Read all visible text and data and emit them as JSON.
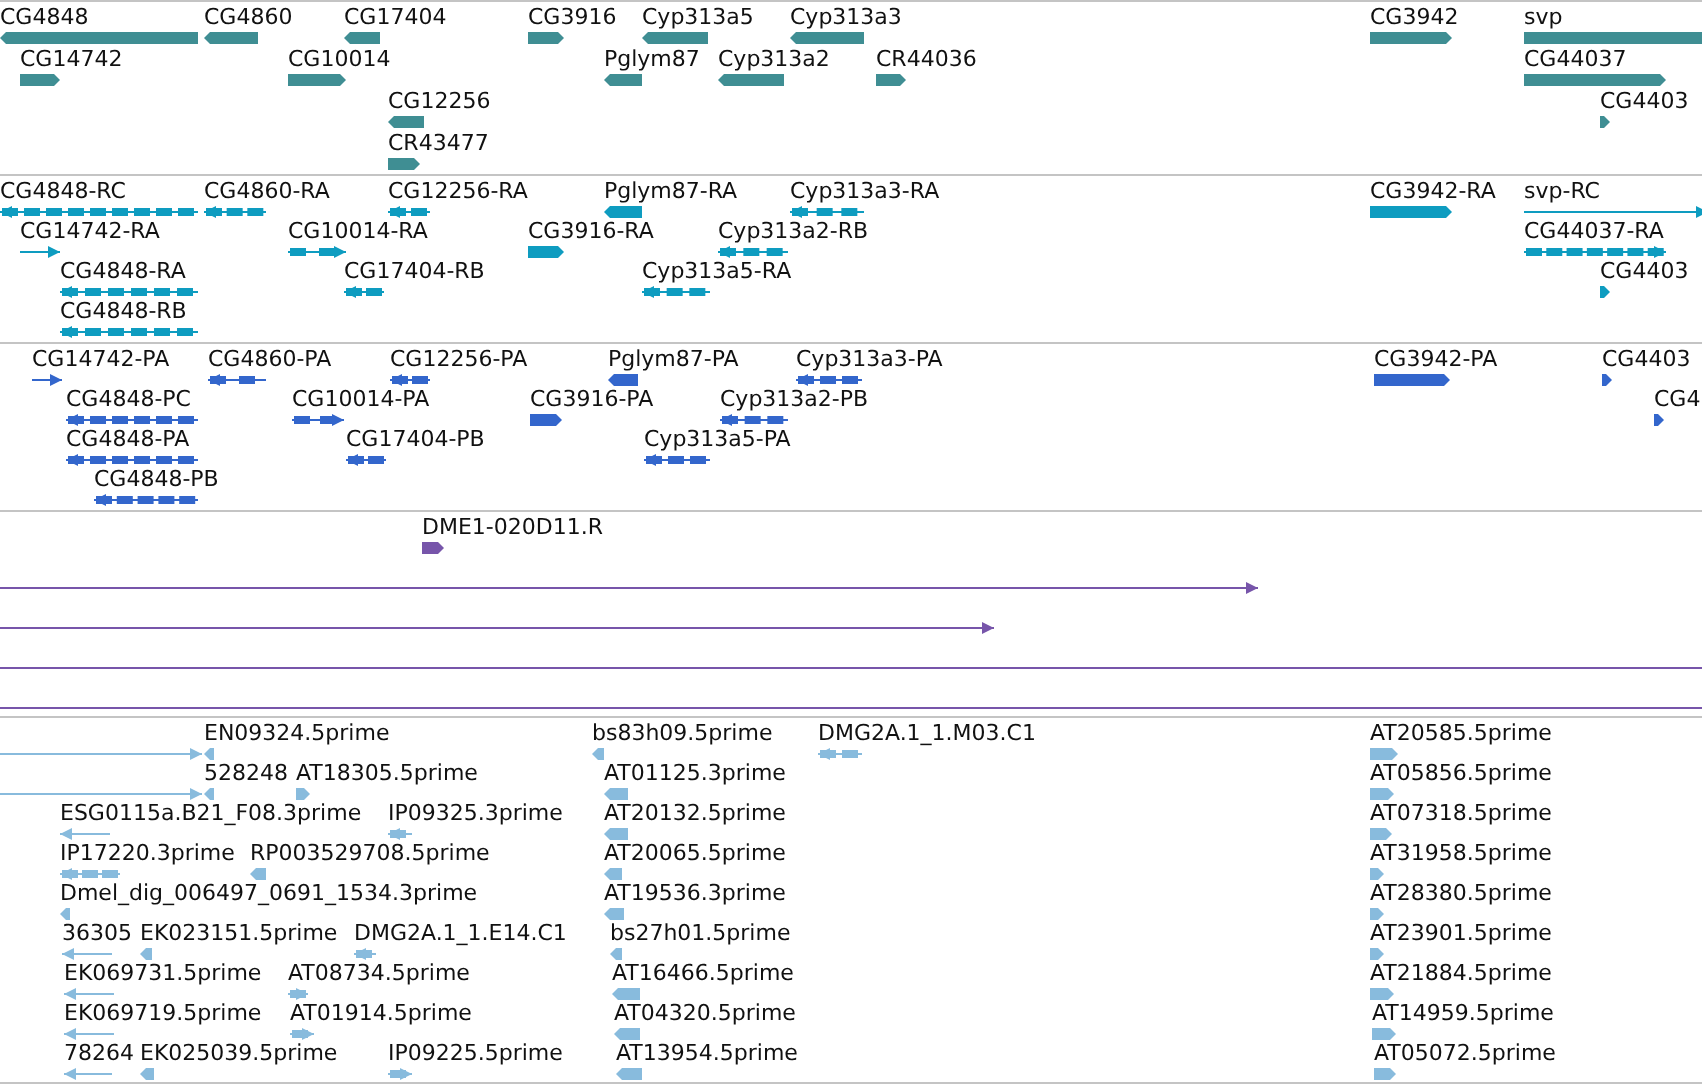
{
  "tracks": [
    {
      "kind": "gene",
      "features": [
        {
          "label": "CG4848",
          "reverse": true
        },
        {
          "label": "CG4860",
          "reverse": true
        },
        {
          "label": "CG17404",
          "reverse": true
        },
        {
          "label": "CG3916",
          "reverse": false
        },
        {
          "label": "Cyp313a5",
          "reverse": true
        },
        {
          "label": "Cyp313a3",
          "reverse": true
        },
        {
          "label": "CG3942",
          "reverse": false
        },
        {
          "label": "svp",
          "reverse": false
        },
        {
          "label": "CG14742",
          "reverse": false
        },
        {
          "label": "CG10014",
          "reverse": false
        },
        {
          "label": "Pglym87",
          "reverse": true
        },
        {
          "label": "Cyp313a2",
          "reverse": true
        },
        {
          "label": "CR44036",
          "reverse": false
        },
        {
          "label": "CG44037",
          "reverse": false
        },
        {
          "label": "CG12256",
          "reverse": true
        },
        {
          "label": "CG4403",
          "reverse": false
        },
        {
          "label": "CR43477",
          "reverse": false
        }
      ]
    },
    {
      "kind": "mrna",
      "features": [
        {
          "label": "CG4848-RC",
          "reverse": true
        },
        {
          "label": "CG4860-RA",
          "reverse": true
        },
        {
          "label": "CG12256-RA",
          "reverse": true
        },
        {
          "label": "Pglym87-RA",
          "reverse": true
        },
        {
          "label": "Cyp313a3-RA",
          "reverse": true
        },
        {
          "label": "CG3942-RA",
          "reverse": false
        },
        {
          "label": "svp-RC",
          "reverse": false
        },
        {
          "label": "CG14742-RA",
          "reverse": false
        },
        {
          "label": "CG10014-RA",
          "reverse": false
        },
        {
          "label": "CG3916-RA",
          "reverse": false
        },
        {
          "label": "Cyp313a2-RB",
          "reverse": true
        },
        {
          "label": "CG44037-RA",
          "reverse": false
        },
        {
          "label": "CG4848-RA",
          "reverse": true
        },
        {
          "label": "CG17404-RB",
          "reverse": true
        },
        {
          "label": "Cyp313a5-RA",
          "reverse": true
        },
        {
          "label": "CG4403",
          "reverse": false
        },
        {
          "label": "CG4848-RB",
          "reverse": true
        }
      ]
    },
    {
      "kind": "protein",
      "features": [
        {
          "label": "CG14742-PA",
          "reverse": false
        },
        {
          "label": "CG4860-PA",
          "reverse": true
        },
        {
          "label": "CG12256-PA",
          "reverse": true
        },
        {
          "label": "Pglym87-PA",
          "reverse": true
        },
        {
          "label": "Cyp313a3-PA",
          "reverse": true
        },
        {
          "label": "CG3942-PA",
          "reverse": false
        },
        {
          "label": "CG4403",
          "reverse": false
        },
        {
          "label": "CG4848-PC",
          "reverse": true
        },
        {
          "label": "CG10014-PA",
          "reverse": false
        },
        {
          "label": "CG3916-PA",
          "reverse": false
        },
        {
          "label": "Cyp313a2-PB",
          "reverse": true
        },
        {
          "label": "CG4",
          "reverse": false
        },
        {
          "label": "CG4848-PA",
          "reverse": true
        },
        {
          "label": "CG17404-PB",
          "reverse": true
        },
        {
          "label": "Cyp313a5-PA",
          "reverse": true
        },
        {
          "label": "CG4848-PB",
          "reverse": true
        }
      ]
    },
    {
      "kind": "clone",
      "features": [
        {
          "kind": "arrow",
          "label": "DME1-020D11.R",
          "reverse": false
        },
        {
          "kind": "arrow",
          "reverse": false
        },
        {
          "kind": "arrow",
          "reverse": false
        },
        {
          "kind": "span"
        },
        {
          "kind": "span"
        }
      ]
    },
    {
      "kind": "est",
      "features": [
        {
          "reverse": false
        },
        {
          "label": "EN09324.5prime",
          "reverse": true
        },
        {
          "label": "bs83h09.5prime",
          "reverse": true
        },
        {
          "label": "DMG2A.1_1.M03.C1",
          "reverse": true
        },
        {
          "label": "AT20585.5prime",
          "reverse": false
        },
        {
          "reverse": false
        },
        {
          "label": "528248",
          "reverse": true
        },
        {
          "label": "AT18305.5prime",
          "reverse": false
        },
        {
          "label": "AT01125.3prime",
          "reverse": true
        },
        {
          "label": "AT05856.5prime",
          "reverse": false
        },
        {
          "label": "ESG0115a.B21_F08.3prime",
          "reverse": true
        },
        {
          "label": "IP09325.3prime",
          "reverse": true
        },
        {
          "label": "AT20132.5prime",
          "reverse": true
        },
        {
          "label": "AT07318.5prime",
          "reverse": false
        },
        {
          "label": "IP17220.3prime",
          "reverse": true
        },
        {
          "label": "RP003529708.5prime",
          "reverse": true
        },
        {
          "label": "AT20065.5prime",
          "reverse": true
        },
        {
          "label": "AT31958.5prime",
          "reverse": false
        },
        {
          "label": "Dmel_dig_006497_0691_1534.3prime",
          "reverse": true
        },
        {
          "label": "AT19536.3prime",
          "reverse": true
        },
        {
          "label": "AT28380.5prime",
          "reverse": false
        },
        {
          "label": "36305",
          "reverse": true
        },
        {
          "label": "EK023151.5prime",
          "reverse": true
        },
        {
          "label": "DMG2A.1_1.E14.C1",
          "reverse": true
        },
        {
          "label": "bs27h01.5prime",
          "reverse": true
        },
        {
          "label": "AT23901.5prime",
          "reverse": false
        },
        {
          "label": "EK069731.5prime",
          "reverse": true
        },
        {
          "label": "AT08734.5prime",
          "reverse": false
        },
        {
          "label": "AT16466.5prime",
          "reverse": true
        },
        {
          "label": "AT21884.5prime",
          "reverse": false
        },
        {
          "label": "EK069719.5prime",
          "reverse": true
        },
        {
          "label": "AT01914.5prime",
          "reverse": false
        },
        {
          "label": "AT04320.5prime",
          "reverse": true
        },
        {
          "label": "AT14959.5prime",
          "reverse": false
        },
        {
          "label": "78264",
          "reverse": true
        },
        {
          "label": "EK025039.5prime",
          "reverse": true
        },
        {
          "label": "IP09225.5prime",
          "reverse": false
        },
        {
          "label": "AT13954.5prime",
          "reverse": true
        },
        {
          "label": "AT05072.5prime",
          "reverse": false
        }
      ]
    }
  ]
}
